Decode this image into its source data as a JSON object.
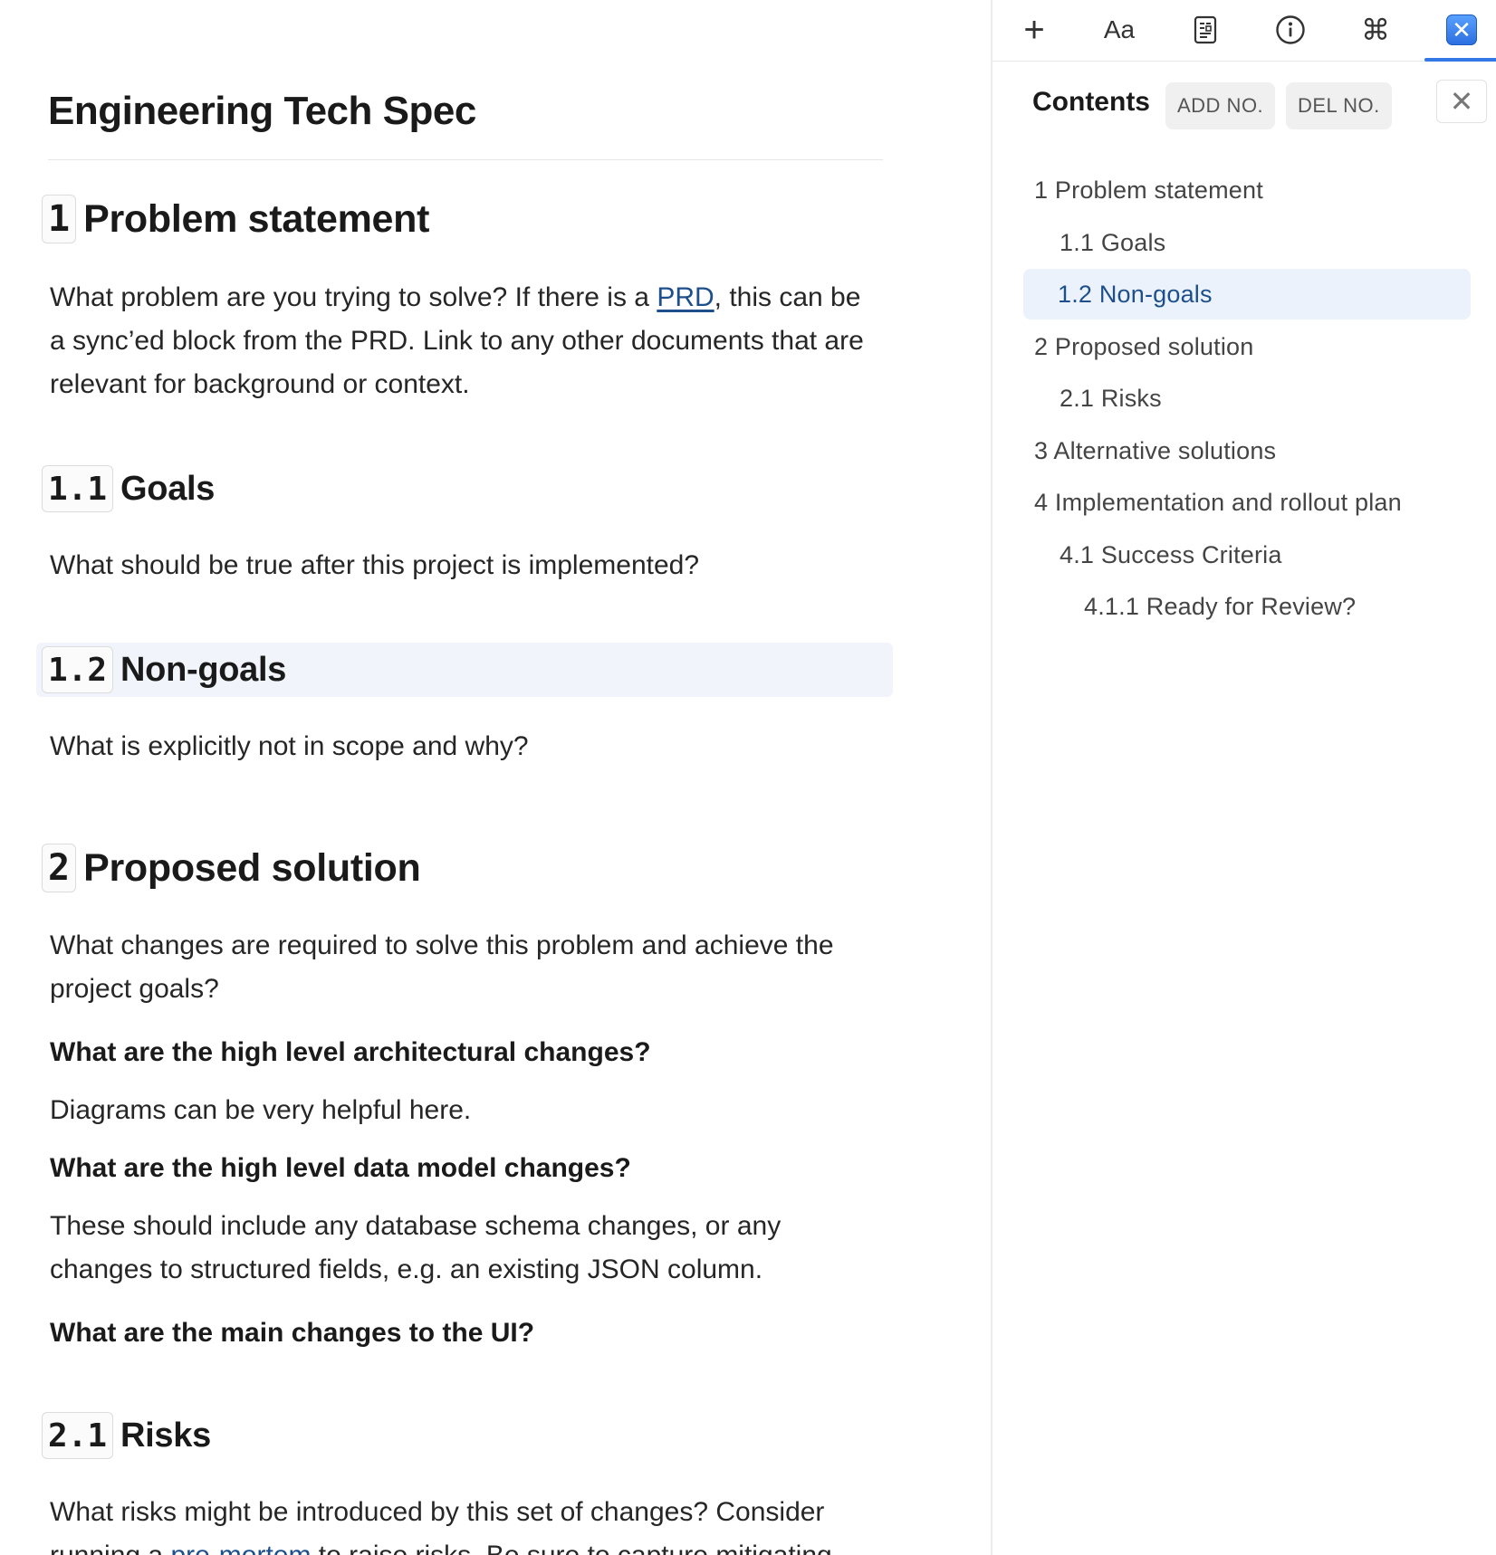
{
  "document": {
    "title": "Engineering Tech Spec",
    "sections": {
      "s1": {
        "number": "1",
        "title": "Problem statement"
      },
      "s1_1": {
        "number": "1.1",
        "title": "Goals"
      },
      "s1_2": {
        "number": "1.2",
        "title": "Non-goals"
      },
      "s2": {
        "number": "2",
        "title": "Proposed solution"
      },
      "s2_1": {
        "number": "2.1",
        "title": "Risks"
      }
    },
    "p1": {
      "before_link": "What problem are you trying to solve? If there is a ",
      "link": "PRD",
      "after_link": ", this can be a sync’ed block from the PRD. Link to any other documents that are relevant for background or context."
    },
    "p_goals": "What should be true after this project is implemented?",
    "p_nongoals": "What is explicitly not in scope and why?",
    "p_proposed": "What changes are required to solve this problem and achieve the project goals?",
    "q_arch": "What are the high level architectural changes?",
    "p_arch": "Diagrams can be very helpful here.",
    "q_data": "What are the high level data model changes?",
    "p_data": "These should include any database schema changes, or any changes to structured fields, e.g. an existing JSON column.",
    "q_ui": "What are the main changes to the UI?",
    "p_risks": {
      "line1": "What risks might be introduced by this set of changes? Consider",
      "line2_before": "running a ",
      "line2_link": "pre-mortem",
      "line2_after": " to raise risks. Be sure to capture mitigating"
    }
  },
  "toolbar": {
    "buttons": [
      {
        "name": "add",
        "icon": "plus-icon",
        "glyph": "+"
      },
      {
        "name": "format",
        "icon": "text-format-icon",
        "glyph": "Aa"
      },
      {
        "name": "template",
        "icon": "document-template-icon",
        "glyph": ""
      },
      {
        "name": "info",
        "icon": "info-icon",
        "glyph": "i"
      },
      {
        "name": "commands",
        "icon": "command-icon",
        "glyph": "⌘"
      },
      {
        "name": "contents",
        "icon": "close-square-icon",
        "glyph": "✕",
        "active": true
      }
    ],
    "accent": "#3478e6"
  },
  "sidebar": {
    "heading": "Contents",
    "add_no": "ADD NO.",
    "del_no": "DEL NO.",
    "close_glyph": "✕",
    "toc": [
      {
        "label": "1 Problem statement",
        "level": 1,
        "active": false
      },
      {
        "label": "1.1 Goals",
        "level": 2,
        "active": false
      },
      {
        "label": "1.2 Non-goals",
        "level": 2,
        "active": true
      },
      {
        "label": "2 Proposed solution",
        "level": 1,
        "active": false
      },
      {
        "label": "2.1 Risks",
        "level": 2,
        "active": false
      },
      {
        "label": "3 Alternative solutions",
        "level": 1,
        "active": false
      },
      {
        "label": "4 Implementation and rollout plan",
        "level": 1,
        "active": false
      },
      {
        "label": "4.1 Success Criteria",
        "level": 2,
        "active": false
      },
      {
        "label": "4.1.1 Ready for Review?",
        "level": 3,
        "active": false
      }
    ]
  },
  "colors": {
    "link": "#1d4f8c",
    "active_toc_bg": "#ebf2fc",
    "highlight_heading_bg": "#f1f5fb"
  }
}
